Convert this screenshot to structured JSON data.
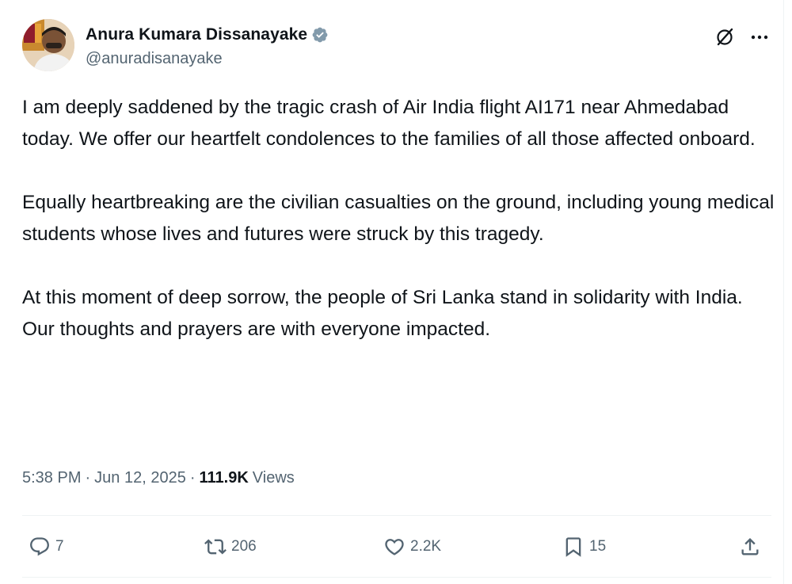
{
  "author": {
    "display_name": "Anura Kumara Dissanayake",
    "handle": "@anuradisanayake",
    "verified": true,
    "verified_color": "#829aab"
  },
  "header_icons": {
    "grok": "grok-slash-icon",
    "more": "more-horizontal-icon"
  },
  "tweet": {
    "paragraphs": [
      "I am deeply saddened by the tragic crash of Air India flight AI171 near Ahmedabad today. We offer our heartfelt condolences to the families of all those affected onboard.",
      "Equally heartbreaking are the civilian casualties on the ground, including young medical students whose lives and futures were struck by this tragedy.",
      "At this moment of deep sorrow, the people of Sri Lanka stand in solidarity with India. Our thoughts and prayers are with everyone impacted."
    ]
  },
  "meta": {
    "time": "5:38 PM",
    "separator": "·",
    "date": "Jun 12, 2025",
    "views_count": "111.9K",
    "views_label": "Views"
  },
  "actions": {
    "reply": {
      "icon": "reply-icon",
      "count": "7"
    },
    "repost": {
      "icon": "repost-icon",
      "count": "206"
    },
    "like": {
      "icon": "heart-icon",
      "count": "2.2K"
    },
    "bookmark": {
      "icon": "bookmark-icon",
      "count": "15"
    },
    "share": {
      "icon": "share-icon"
    }
  },
  "colors": {
    "text": "#0f1419",
    "secondary": "#536471",
    "divider": "#eff3f4"
  }
}
